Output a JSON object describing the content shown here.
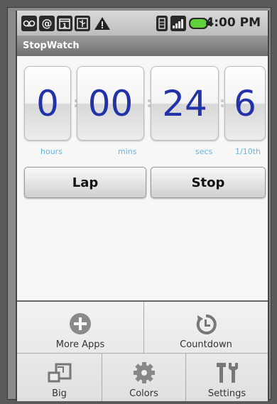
{
  "status_bar": {
    "icons": [
      "voicemail-icon",
      "at-icon",
      "calendar-icon",
      "usb-icon",
      "warning-icon",
      "sim-icon",
      "signal-icon",
      "battery-icon"
    ],
    "time": "4:00 PM"
  },
  "app": {
    "title": "StopWatch"
  },
  "timer": {
    "hours": "0",
    "mins": "00",
    "secs": "24",
    "tenths": "6",
    "separator": ":",
    "labels": {
      "hours": "hours",
      "mins": "mins",
      "secs": "secs",
      "tenths": "1/10th"
    }
  },
  "buttons": {
    "lap": "Lap",
    "stop": "Stop"
  },
  "menu": {
    "items": [
      {
        "label": "More Apps",
        "icon": "plus-circle-icon"
      },
      {
        "label": "Countdown",
        "icon": "countdown-icon"
      },
      {
        "label": "Big",
        "icon": "resize-icon"
      },
      {
        "label": "Colors",
        "icon": "gear-icon"
      },
      {
        "label": "Settings",
        "icon": "tools-icon"
      }
    ]
  },
  "colors": {
    "digit": "#2233aa",
    "unit_label": "#69b4e0"
  }
}
